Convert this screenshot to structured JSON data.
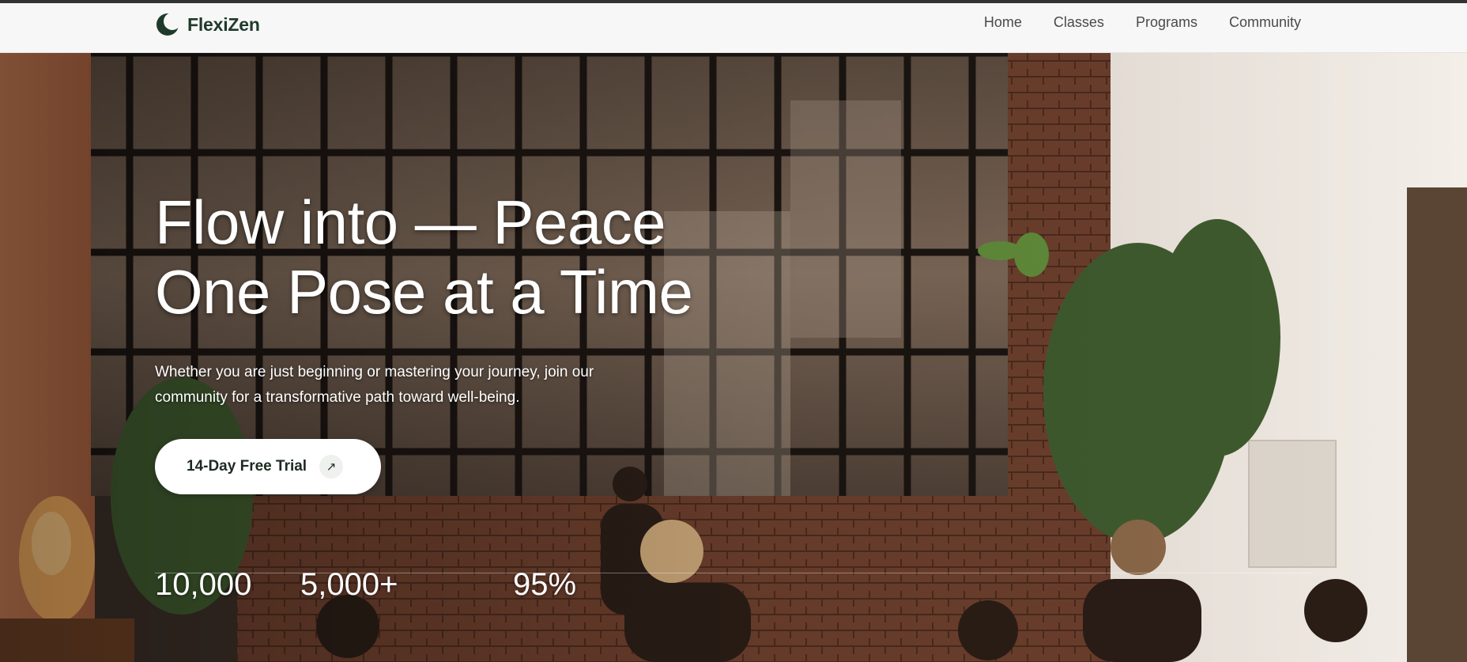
{
  "header": {
    "brand": "FlexiZen",
    "nav": [
      "Home",
      "Classes",
      "Programs",
      "Community"
    ]
  },
  "hero": {
    "title_line1": "Flow into — Peace",
    "title_line2": "One Pose at a Time",
    "subtitle": "Whether you are just beginning or mastering your journey, join our community for a transformative path toward well-being.",
    "cta_label": "14-Day Free Trial",
    "cta_icon": "arrow-up-right-icon"
  },
  "stats": [
    "10,000",
    "5,000+",
    "95%"
  ],
  "colors": {
    "brand_green": "#1f3a2a",
    "header_bg": "#f7f7f7",
    "nav_text": "#4a4a4a",
    "cta_bg": "#ffffff"
  }
}
